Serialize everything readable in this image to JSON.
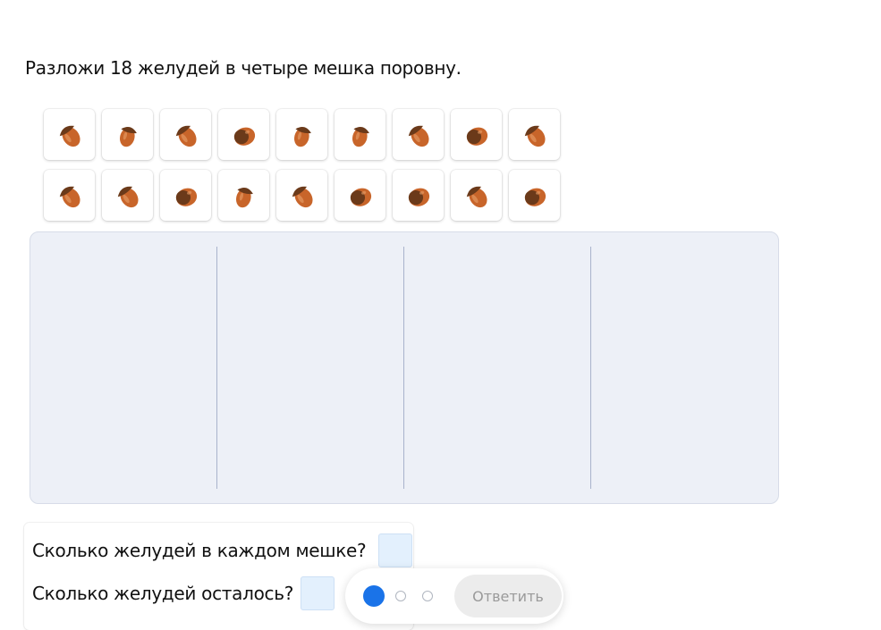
{
  "task": {
    "title": "Разложи 18 желудей в четыре мешка поровну."
  },
  "acorns": {
    "count": 18,
    "icon": "acorn-icon",
    "variants": [
      "tilted-left",
      "upright",
      "tilted-left",
      "dark-round",
      "upright",
      "upright",
      "tilted-left",
      "dark-round",
      "tilted-left",
      "tilted-left",
      "tilted-left",
      "dark-round",
      "upright",
      "tilted-left",
      "dark-round",
      "dark-round",
      "tilted-left",
      "dark-round"
    ]
  },
  "bags": {
    "count": 4
  },
  "questions": [
    {
      "label": "Сколько желудей в каждом мешке?",
      "value": ""
    },
    {
      "label": "Сколько желудей осталось?",
      "value": ""
    }
  ],
  "progress": {
    "current_step": 1,
    "total_steps": 3
  },
  "submit": {
    "label": "Ответить"
  },
  "colors": {
    "active_dot": "#1a73e8",
    "answer_box": "#e3f0fd",
    "bag_area": "#edf0f7",
    "acorn_body": "#c8652a",
    "acorn_cap": "#6b3a1a"
  }
}
